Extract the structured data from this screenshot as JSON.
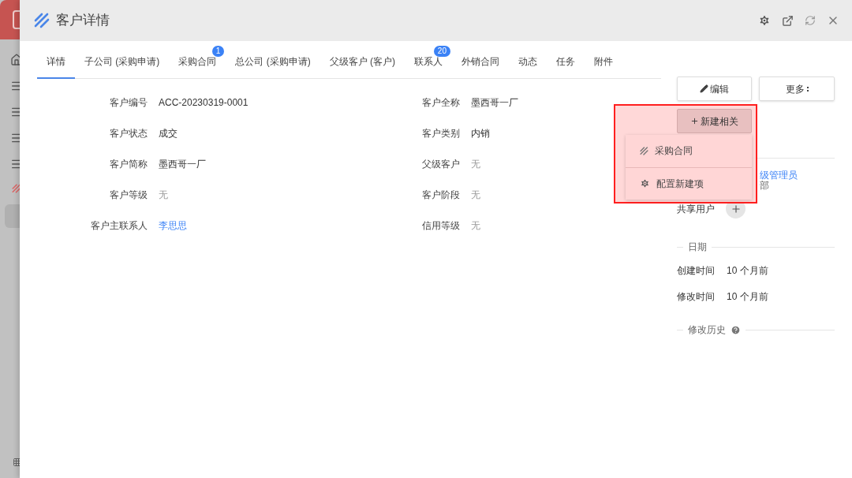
{
  "window": {
    "title": "客户详情"
  },
  "tabs": [
    {
      "label": "详情",
      "selected": true
    },
    {
      "label": "子公司 (采购申请)",
      "selected": false
    },
    {
      "label": "采购合同",
      "selected": false,
      "badge": "1"
    },
    {
      "label": "总公司 (采购申请)",
      "selected": false
    },
    {
      "label": "父级客户 (客户)",
      "selected": false
    },
    {
      "label": "联系人",
      "selected": false,
      "badge": "20"
    },
    {
      "label": "外销合同",
      "selected": false
    },
    {
      "label": "动态",
      "selected": false
    },
    {
      "label": "任务",
      "selected": false
    },
    {
      "label": "附件",
      "selected": false
    }
  ],
  "fields": [
    {
      "label": "客户编号",
      "value": "ACC-20230319-0001",
      "kind": "text"
    },
    {
      "label": "客户全称",
      "value": "墨西哥一厂",
      "kind": "text"
    },
    {
      "label": "客户状态",
      "value": "成交",
      "kind": "text"
    },
    {
      "label": "客户类别",
      "value": "内销",
      "kind": "text"
    },
    {
      "label": "客户简称",
      "value": "墨西哥一厂",
      "kind": "text"
    },
    {
      "label": "父级客户",
      "value": "无",
      "kind": "empty"
    },
    {
      "label": "客户等级",
      "value": "无",
      "kind": "empty"
    },
    {
      "label": "客户阶段",
      "value": "无",
      "kind": "empty"
    },
    {
      "label": "客户主联系人",
      "value": "李思思",
      "kind": "link"
    },
    {
      "label": "信用等级",
      "value": "无",
      "kind": "empty"
    }
  ],
  "actions": {
    "edit": "编辑",
    "more": "更多",
    "new_related": "新建相关"
  },
  "dropdown": [
    {
      "label": "采购合同",
      "kind": "stripes"
    },
    {
      "label": "配置新建项",
      "kind": "gear"
    }
  ],
  "owner": {
    "name": "级管理员",
    "dept": "部"
  },
  "shared": {
    "label": "共享用户"
  },
  "dates": {
    "title": "日期",
    "rows": [
      {
        "label": "创建时间",
        "value": "10 个月前"
      },
      {
        "label": "修改时间",
        "value": "10 个月前"
      }
    ]
  },
  "history": {
    "title": "修改历史"
  }
}
